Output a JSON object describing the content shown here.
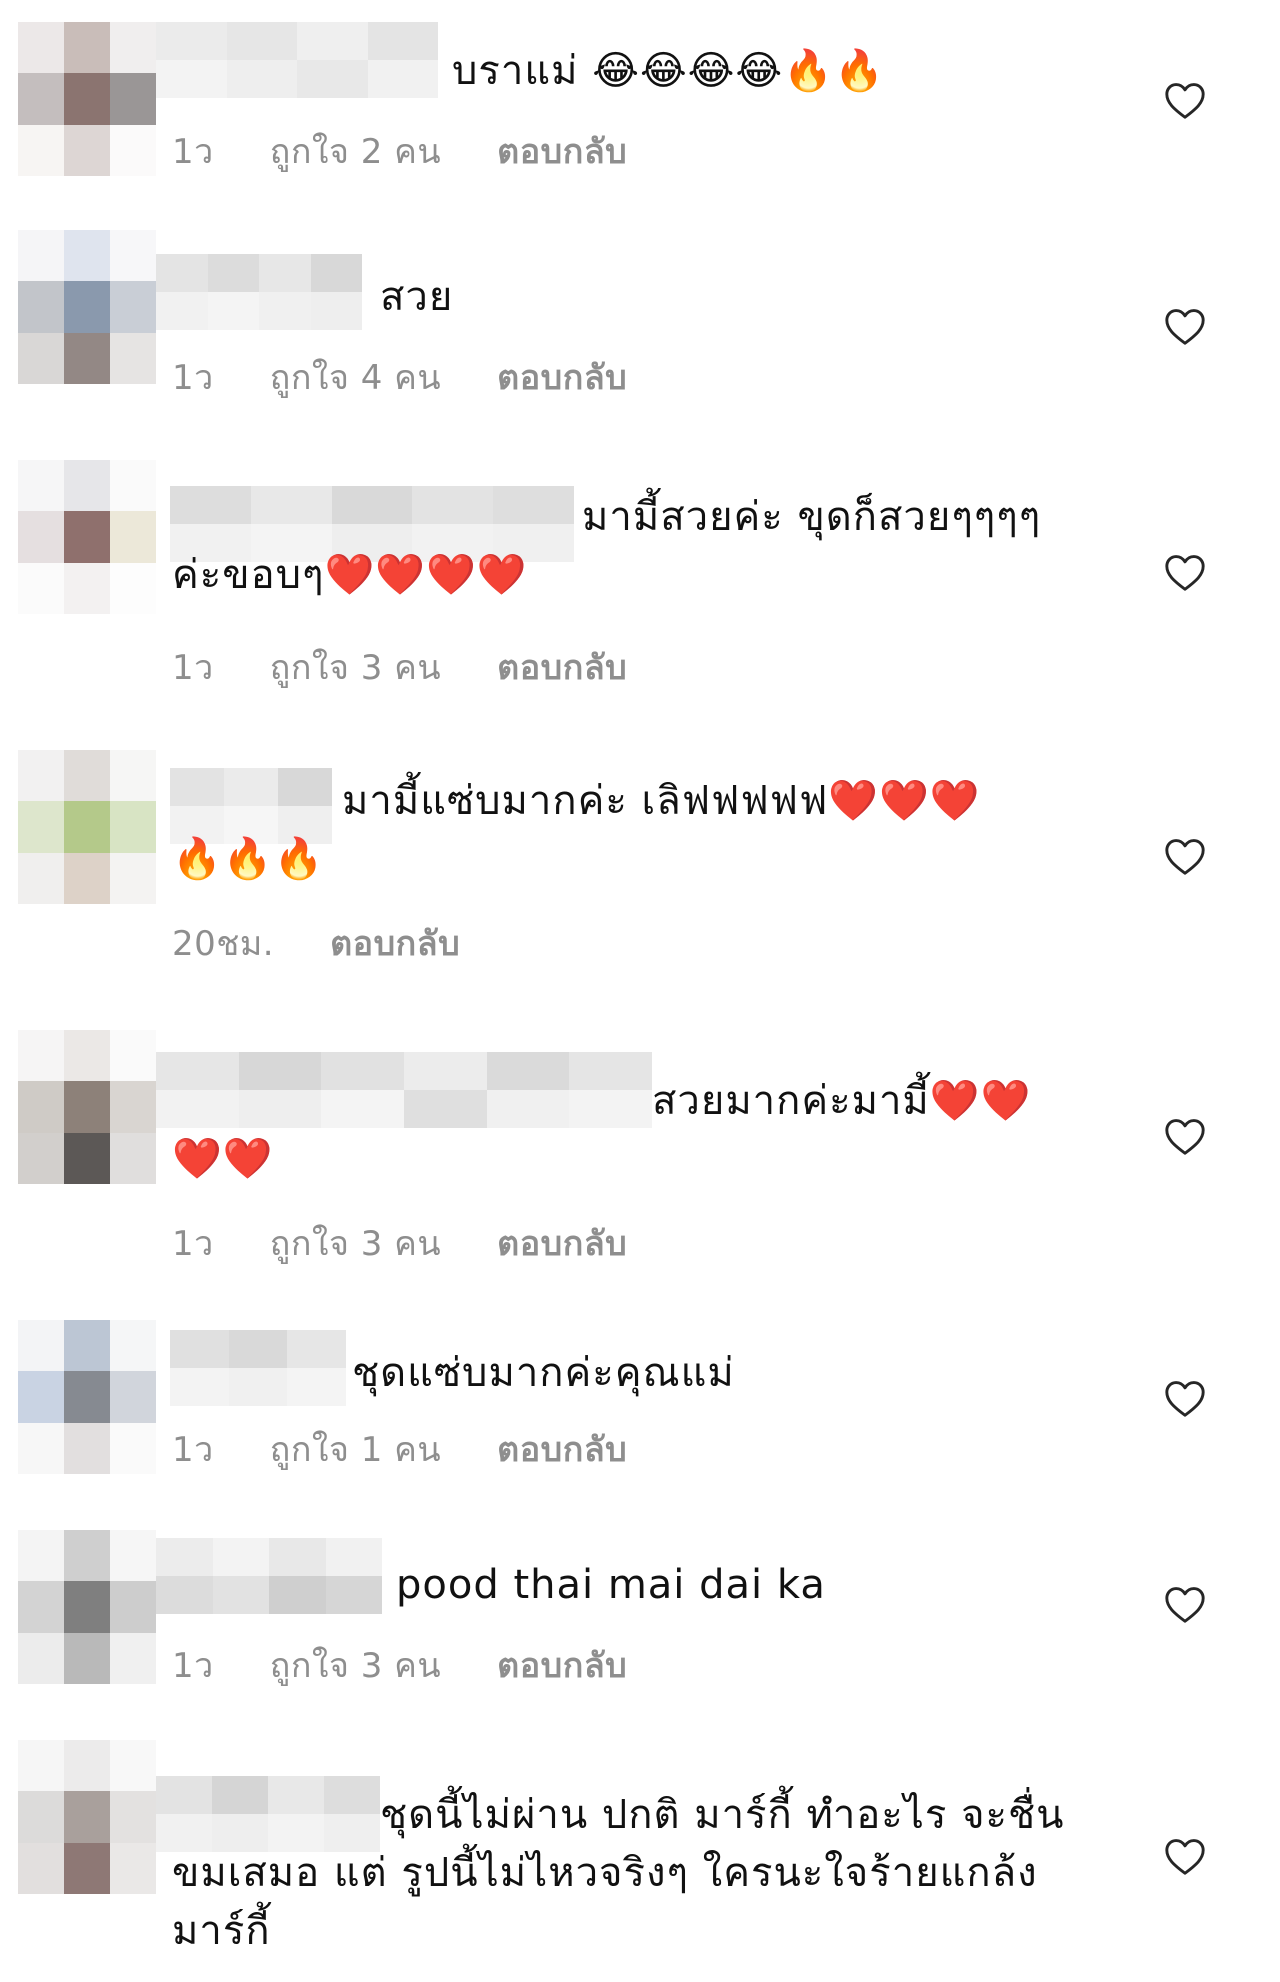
{
  "comments": [
    {
      "text": "บราแม่ 😂😂😂😂🔥🔥",
      "time": "1ว",
      "likes": "ถูกใจ 2 คน",
      "reply": "ตอบกลับ"
    },
    {
      "text": "สวย",
      "time": "1ว",
      "likes": "ถูกใจ 4 คน",
      "reply": "ตอบกลับ"
    },
    {
      "text": "มามี้สวยค่ะ ขุดก็สวยๆๆๆๆ\nค่ะขอบๆ❤️❤️❤️❤️",
      "time": "1ว",
      "likes": "ถูกใจ 3 คน",
      "reply": "ตอบกลับ"
    },
    {
      "text": "มามี้แซ่บมากค่ะ เลิฟฟฟฟฟ❤️❤️❤️\n🔥🔥🔥",
      "time": "20ชม.",
      "likes": "",
      "reply": "ตอบกลับ"
    },
    {
      "text": "สวยมากค่ะมามี้❤️❤️\n❤️❤️",
      "time": "1ว",
      "likes": "ถูกใจ 3 คน",
      "reply": "ตอบกลับ"
    },
    {
      "text": "ชุดแซ่บมากค่ะคุณแม่",
      "time": "1ว",
      "likes": "ถูกใจ 1 คน",
      "reply": "ตอบกลับ"
    },
    {
      "text": "pood thai mai dai ka",
      "time": "1ว",
      "likes": "ถูกใจ 3 คน",
      "reply": "ตอบกลับ"
    },
    {
      "text": "ชุดนี้ไม่ผ่าน ปกติ มาร์กี้ ทำอะไร จะชื่น\nขมเสมอ แต่ รูปนี้ไม่ไหวจริงๆ ใครนะใจร้ายแกล้ง\nมาร์กี้",
      "time": "",
      "likes": "",
      "reply": ""
    }
  ],
  "icons": {
    "like": "heart-outline-icon"
  },
  "colors": {
    "meta": "#8e8e8e",
    "text": "#111111"
  }
}
